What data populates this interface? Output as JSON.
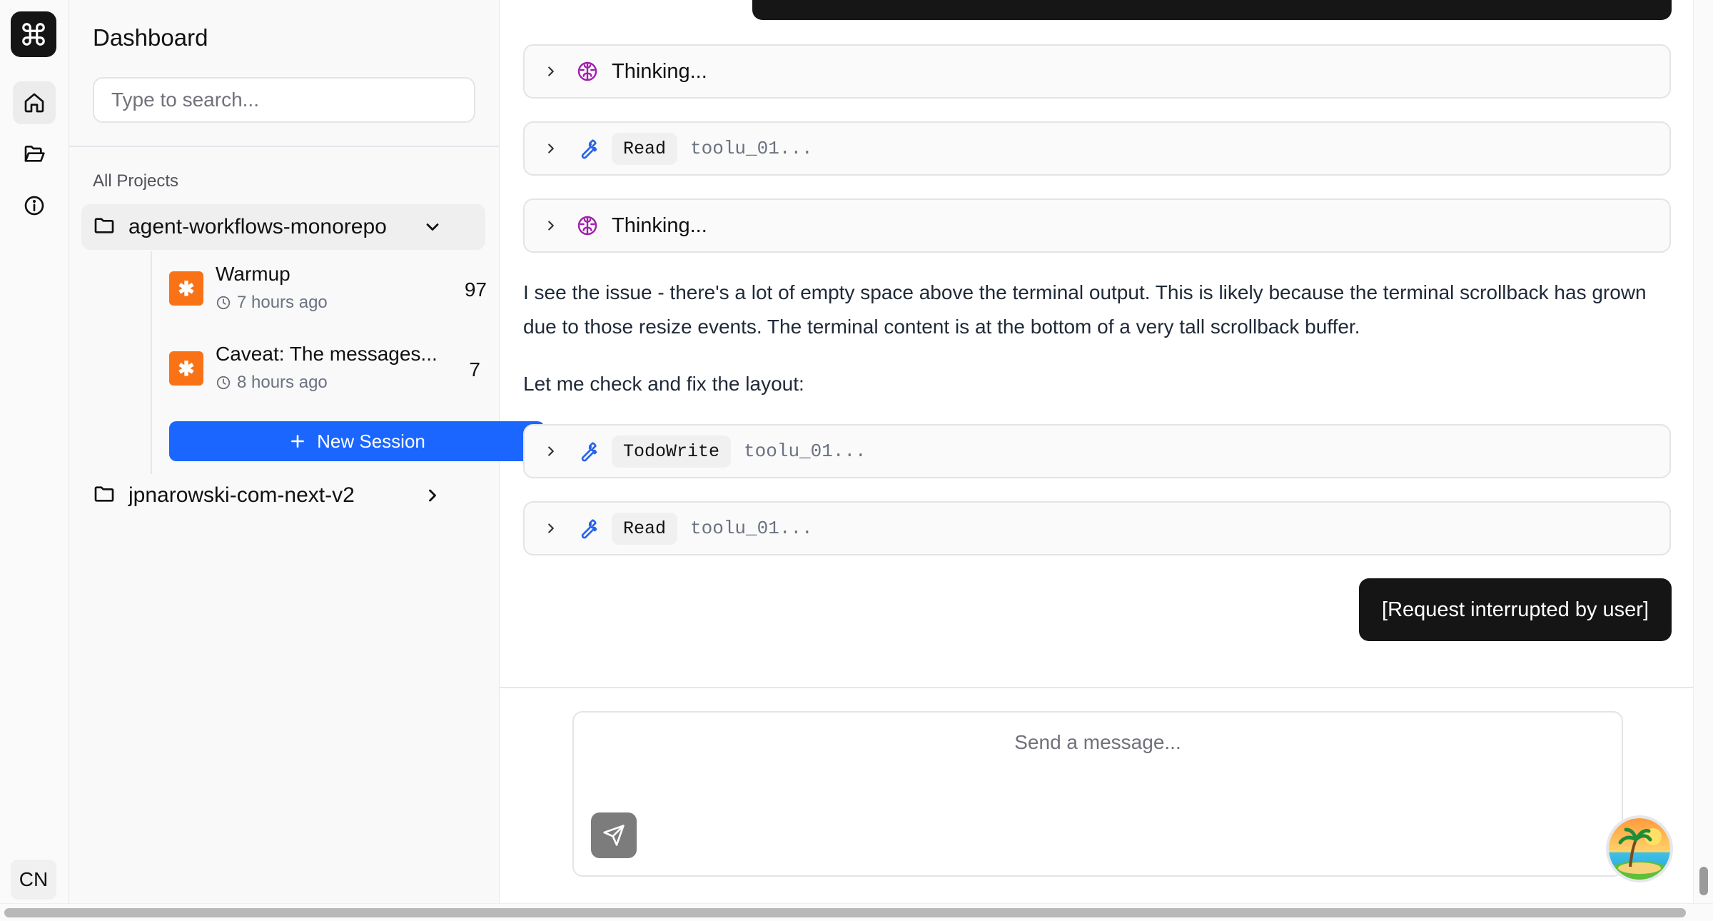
{
  "rail": {
    "logo_icon": "command-icon",
    "items": [
      "home-icon",
      "folder-open-icon",
      "info-icon"
    ],
    "language": "CN"
  },
  "sidebar": {
    "title": "Dashboard",
    "search_placeholder": "Type to search...",
    "section_label": "All Projects",
    "projects": [
      {
        "name": "agent-workflows-monorepo",
        "expanded": true,
        "sessions": [
          {
            "title": "Warmup",
            "time": "7 hours ago",
            "count": "97"
          },
          {
            "title": "Caveat: The messages...",
            "time": "8 hours ago",
            "count": "7"
          }
        ],
        "new_session_label": "New Session"
      },
      {
        "name": "jpnarowski-com-next-v2",
        "expanded": false
      }
    ]
  },
  "conversation": {
    "items": [
      {
        "kind": "thinking",
        "label": "Thinking..."
      },
      {
        "kind": "tool",
        "name": "Read",
        "id": "toolu_01..."
      },
      {
        "kind": "thinking",
        "label": "Thinking..."
      },
      {
        "kind": "text",
        "paragraphs": [
          "I see the issue - there's a lot of empty space above the terminal output. This is likely because the terminal scrollback has grown due to those resize events. The terminal content is at the bottom of a very tall scrollback buffer.",
          "Let me check and fix the layout:"
        ]
      },
      {
        "kind": "tool",
        "name": "TodoWrite",
        "id": "toolu_01..."
      },
      {
        "kind": "tool",
        "name": "Read",
        "id": "toolu_01..."
      }
    ],
    "user_message": "[Request interrupted by user]"
  },
  "composer": {
    "placeholder": "Send a message...",
    "send_icon": "send-icon",
    "avatar_icon": "beach-avatar-icon"
  },
  "colors": {
    "accent": "#1a66ff",
    "session_badge": "#f97316",
    "thinking_icon": "#a21caf",
    "tool_icon": "#2563eb"
  }
}
